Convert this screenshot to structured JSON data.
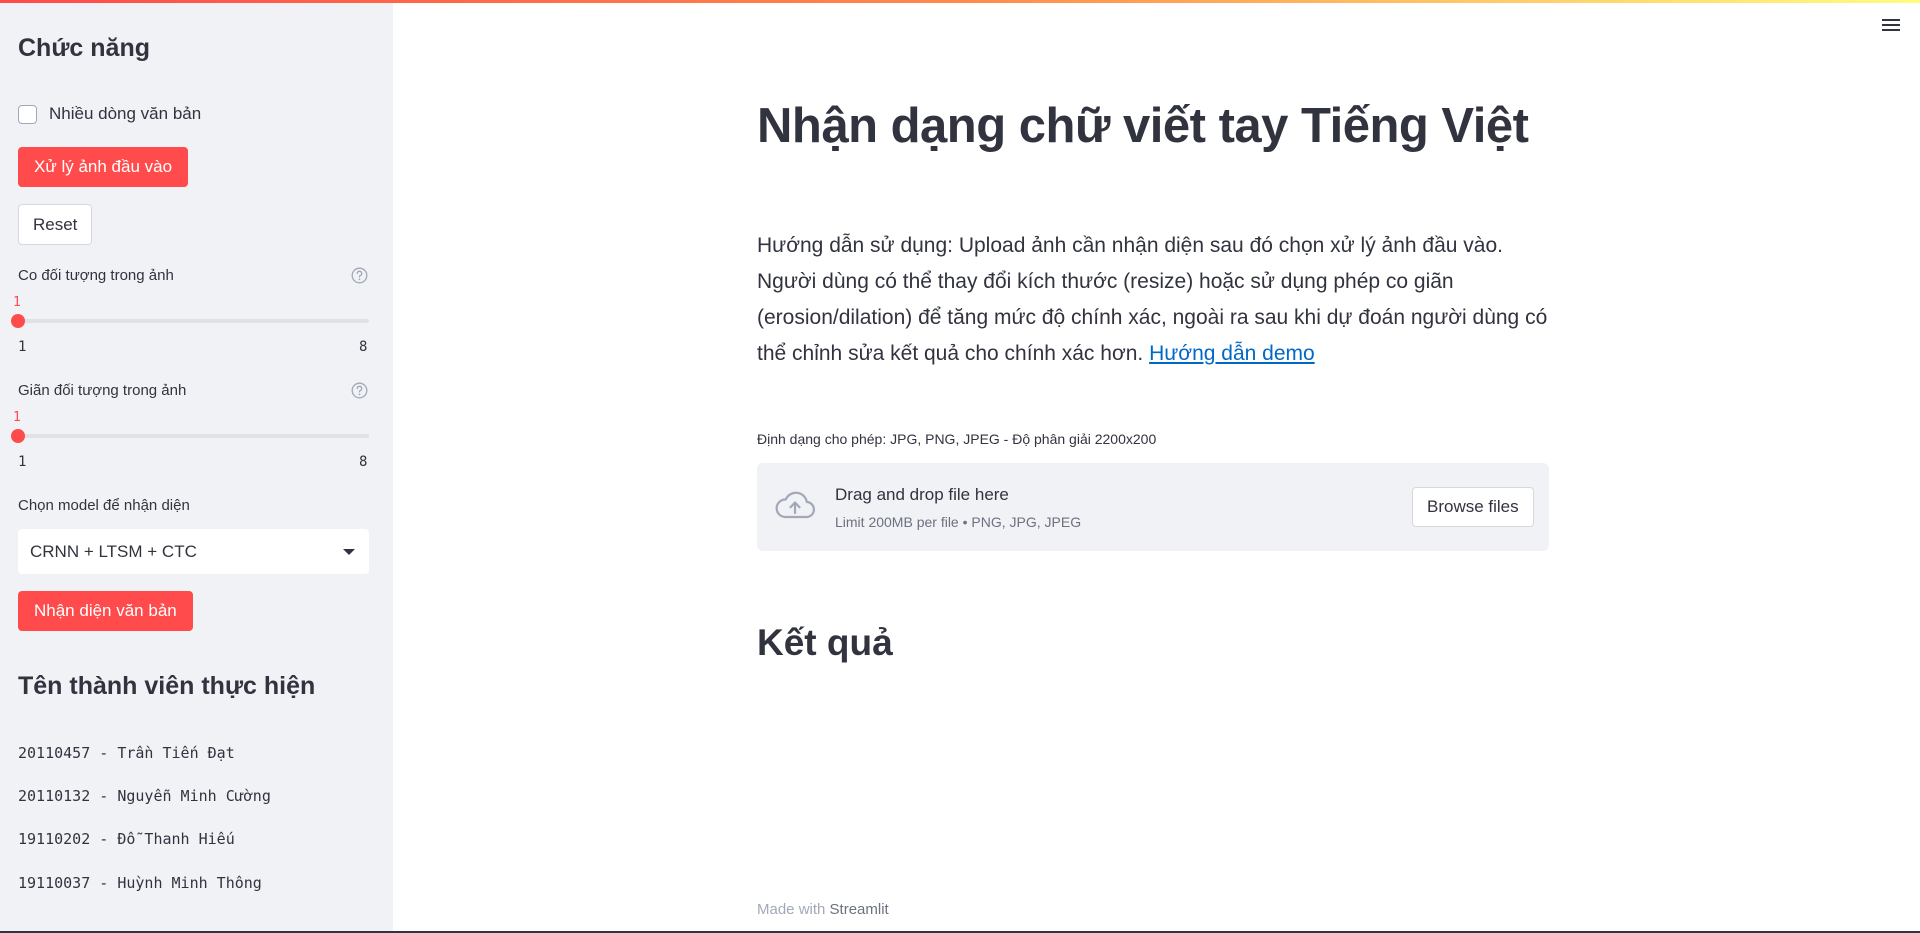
{
  "sidebar": {
    "title": "Chức năng",
    "multiline_checkbox": {
      "label": "Nhiều dòng văn bản",
      "checked": false
    },
    "process_button": "Xử lý ảnh đầu vào",
    "reset_button": "Reset",
    "erosion_slider": {
      "label": "Co đối tượng trong ảnh",
      "value": "1",
      "min": "1",
      "max": "8",
      "help_icon": "question-circle-icon"
    },
    "dilation_slider": {
      "label": "Giãn đối tượng trong ảnh",
      "value": "1",
      "min": "1",
      "max": "8",
      "help_icon": "question-circle-icon"
    },
    "model_select": {
      "label": "Chọn model để nhận diện",
      "value": "CRNN + LTSM + CTC"
    },
    "recognize_button": "Nhận diện văn bản",
    "members_title": "Tên thành viên thực hiện",
    "members": [
      "20110457 - Trần Tiến Đạt",
      "20110132 - Nguyễn Minh Cường",
      "19110202 - Đỗ Thanh Hiếu",
      "19110037 - Huỳnh Minh Thông"
    ]
  },
  "main": {
    "title": "Nhận dạng chữ viết tay Tiếng Việt",
    "guide_text": "Hướng dẫn sử dụng: Upload ảnh cần nhận diện sau đó chọn xử lý ảnh đầu vào. Người dùng có thể thay đổi kích thước (resize) hoặc sử dụng phép co giãn (erosion/dilation) để tăng mức độ chính xác, ngoài ra sau khi dự đoán người dùng có thể chỉnh sửa kết quả cho chính xác hơn.",
    "guide_link": "Hướng dẫn demo",
    "uploader": {
      "label": "Định dạng cho phép: JPG, PNG, JPEG - Độ phân giải 2200x200",
      "drop_text": "Drag and drop file here",
      "limit_text": "Limit 200MB per file • PNG, JPG, JPEG",
      "browse_button": "Browse files",
      "icon": "cloud-upload-icon"
    },
    "result_title": "Kết quả"
  },
  "footer": {
    "made_with": "Made with",
    "brand": "Streamlit"
  },
  "colors": {
    "primary": "#ff4b4b",
    "sidebar_bg": "#f0f2f6",
    "text": "#31333f",
    "link": "#0068c9"
  }
}
